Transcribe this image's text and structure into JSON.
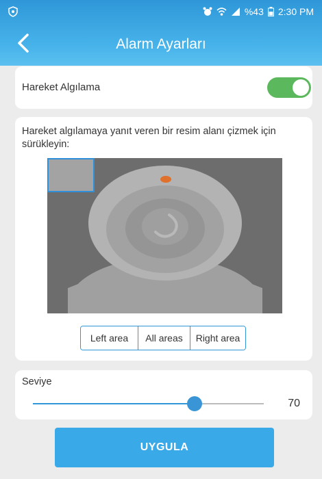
{
  "statusbar": {
    "left_icon": "shield-icon",
    "battery_text": "%43",
    "time": "2:30 PM"
  },
  "header": {
    "title": "Alarm Ayarları",
    "back_icon": "chevron-left-icon"
  },
  "motion_detection": {
    "label": "Hareket Algılama",
    "enabled": true
  },
  "area": {
    "hint": "Hareket algılamaya yanıt veren bir resim alanı çizmek için sürükleyin:",
    "buttons": {
      "left": "Left area",
      "all": "All areas",
      "right": "Right area"
    }
  },
  "level": {
    "label": "Seviye",
    "value": "70",
    "fraction": 0.7
  },
  "apply_label": "UYGULA",
  "colors": {
    "header_blue": "#2f97d8",
    "toggle_green": "#5cb85c",
    "accent_blue": "#3aa9e8"
  }
}
